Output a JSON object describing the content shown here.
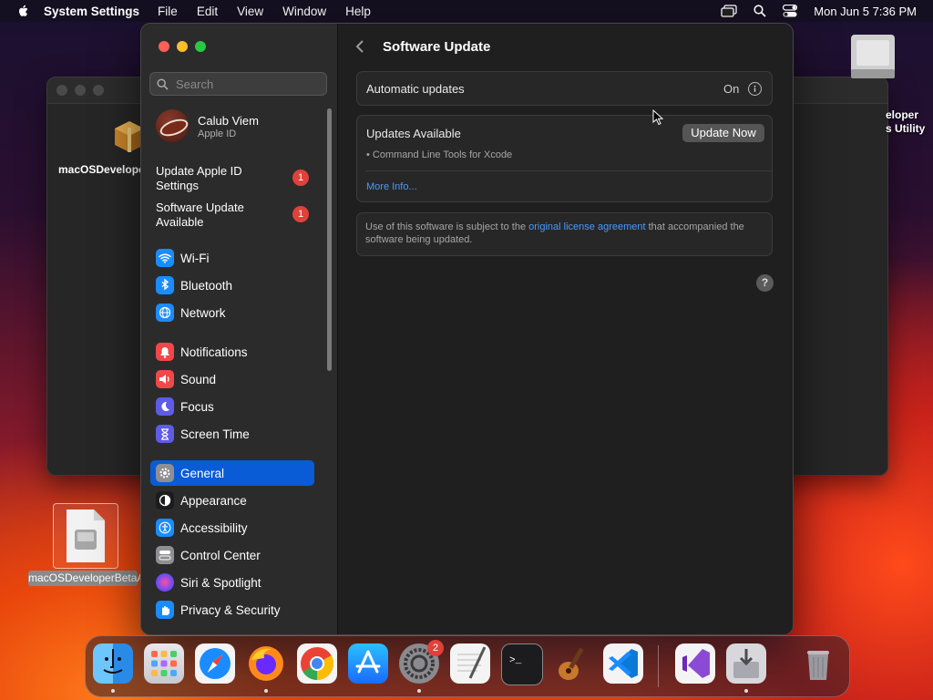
{
  "menubar": {
    "app": "System Settings",
    "items": [
      "File",
      "Edit",
      "View",
      "Window",
      "Help"
    ],
    "datetime": "Mon Jun 5  7:36 PM"
  },
  "desktop": {
    "bg_window_icon_label": "macOSDevelopersUtility",
    "disk_label": "eloper\ns Utility",
    "dmg_label": "macOSDeveloperBetaAcce...ility.dmg"
  },
  "sidebar": {
    "search_placeholder": "Search",
    "user": {
      "name": "Calub Viem",
      "subtitle": "Apple ID"
    },
    "notices": [
      {
        "label": "Update Apple ID Settings",
        "badge": "1"
      },
      {
        "label": "Software Update Available",
        "badge": "1"
      }
    ],
    "items": [
      {
        "label": "Wi-Fi",
        "icon": "wifi-icon",
        "color": "#1a8cff"
      },
      {
        "label": "Bluetooth",
        "icon": "bluetooth-icon",
        "color": "#1a8cff"
      },
      {
        "label": "Network",
        "icon": "globe-icon",
        "color": "#1a8cff"
      },
      {
        "label": "Notifications",
        "icon": "bell-icon",
        "color": "#f04848"
      },
      {
        "label": "Sound",
        "icon": "speaker-icon",
        "color": "#f04848"
      },
      {
        "label": "Focus",
        "icon": "moon-icon",
        "color": "#5e5ce6"
      },
      {
        "label": "Screen Time",
        "icon": "hourglass-icon",
        "color": "#5e5ce6"
      },
      {
        "label": "General",
        "icon": "gear-icon",
        "color": "#8e8e93"
      },
      {
        "label": "Appearance",
        "icon": "appearance-icon",
        "color": "#1c1c1e"
      },
      {
        "label": "Accessibility",
        "icon": "accessibility-icon",
        "color": "#1a8cff"
      },
      {
        "label": "Control Center",
        "icon": "control-center-icon",
        "color": "#8e8e93"
      },
      {
        "label": "Siri & Spotlight",
        "icon": "siri-icon",
        "color": "#c04cd8"
      },
      {
        "label": "Privacy & Security",
        "icon": "hand-icon",
        "color": "#1a8cff"
      }
    ],
    "selected": "General"
  },
  "content": {
    "title": "Software Update",
    "auto_updates": {
      "label": "Automatic updates",
      "value": "On"
    },
    "updates": {
      "heading": "Updates Available",
      "button": "Update Now",
      "item": "• Command Line Tools for Xcode",
      "more": "More Info..."
    },
    "legal": {
      "pre": "Use of this software is subject to the ",
      "link": "original license agreement",
      "post": " that accompanied the software being updated."
    },
    "help": "?"
  },
  "dock": {
    "apps": [
      "Finder",
      "Launchpad",
      "Safari",
      "Firefox",
      "Chrome",
      "App Store",
      "System Settings",
      "TextEdit",
      "Terminal",
      "GarageBand",
      "Visual Studio Code",
      "Visual Studio",
      "Installer",
      "Trash"
    ],
    "settings_badge": "2"
  }
}
